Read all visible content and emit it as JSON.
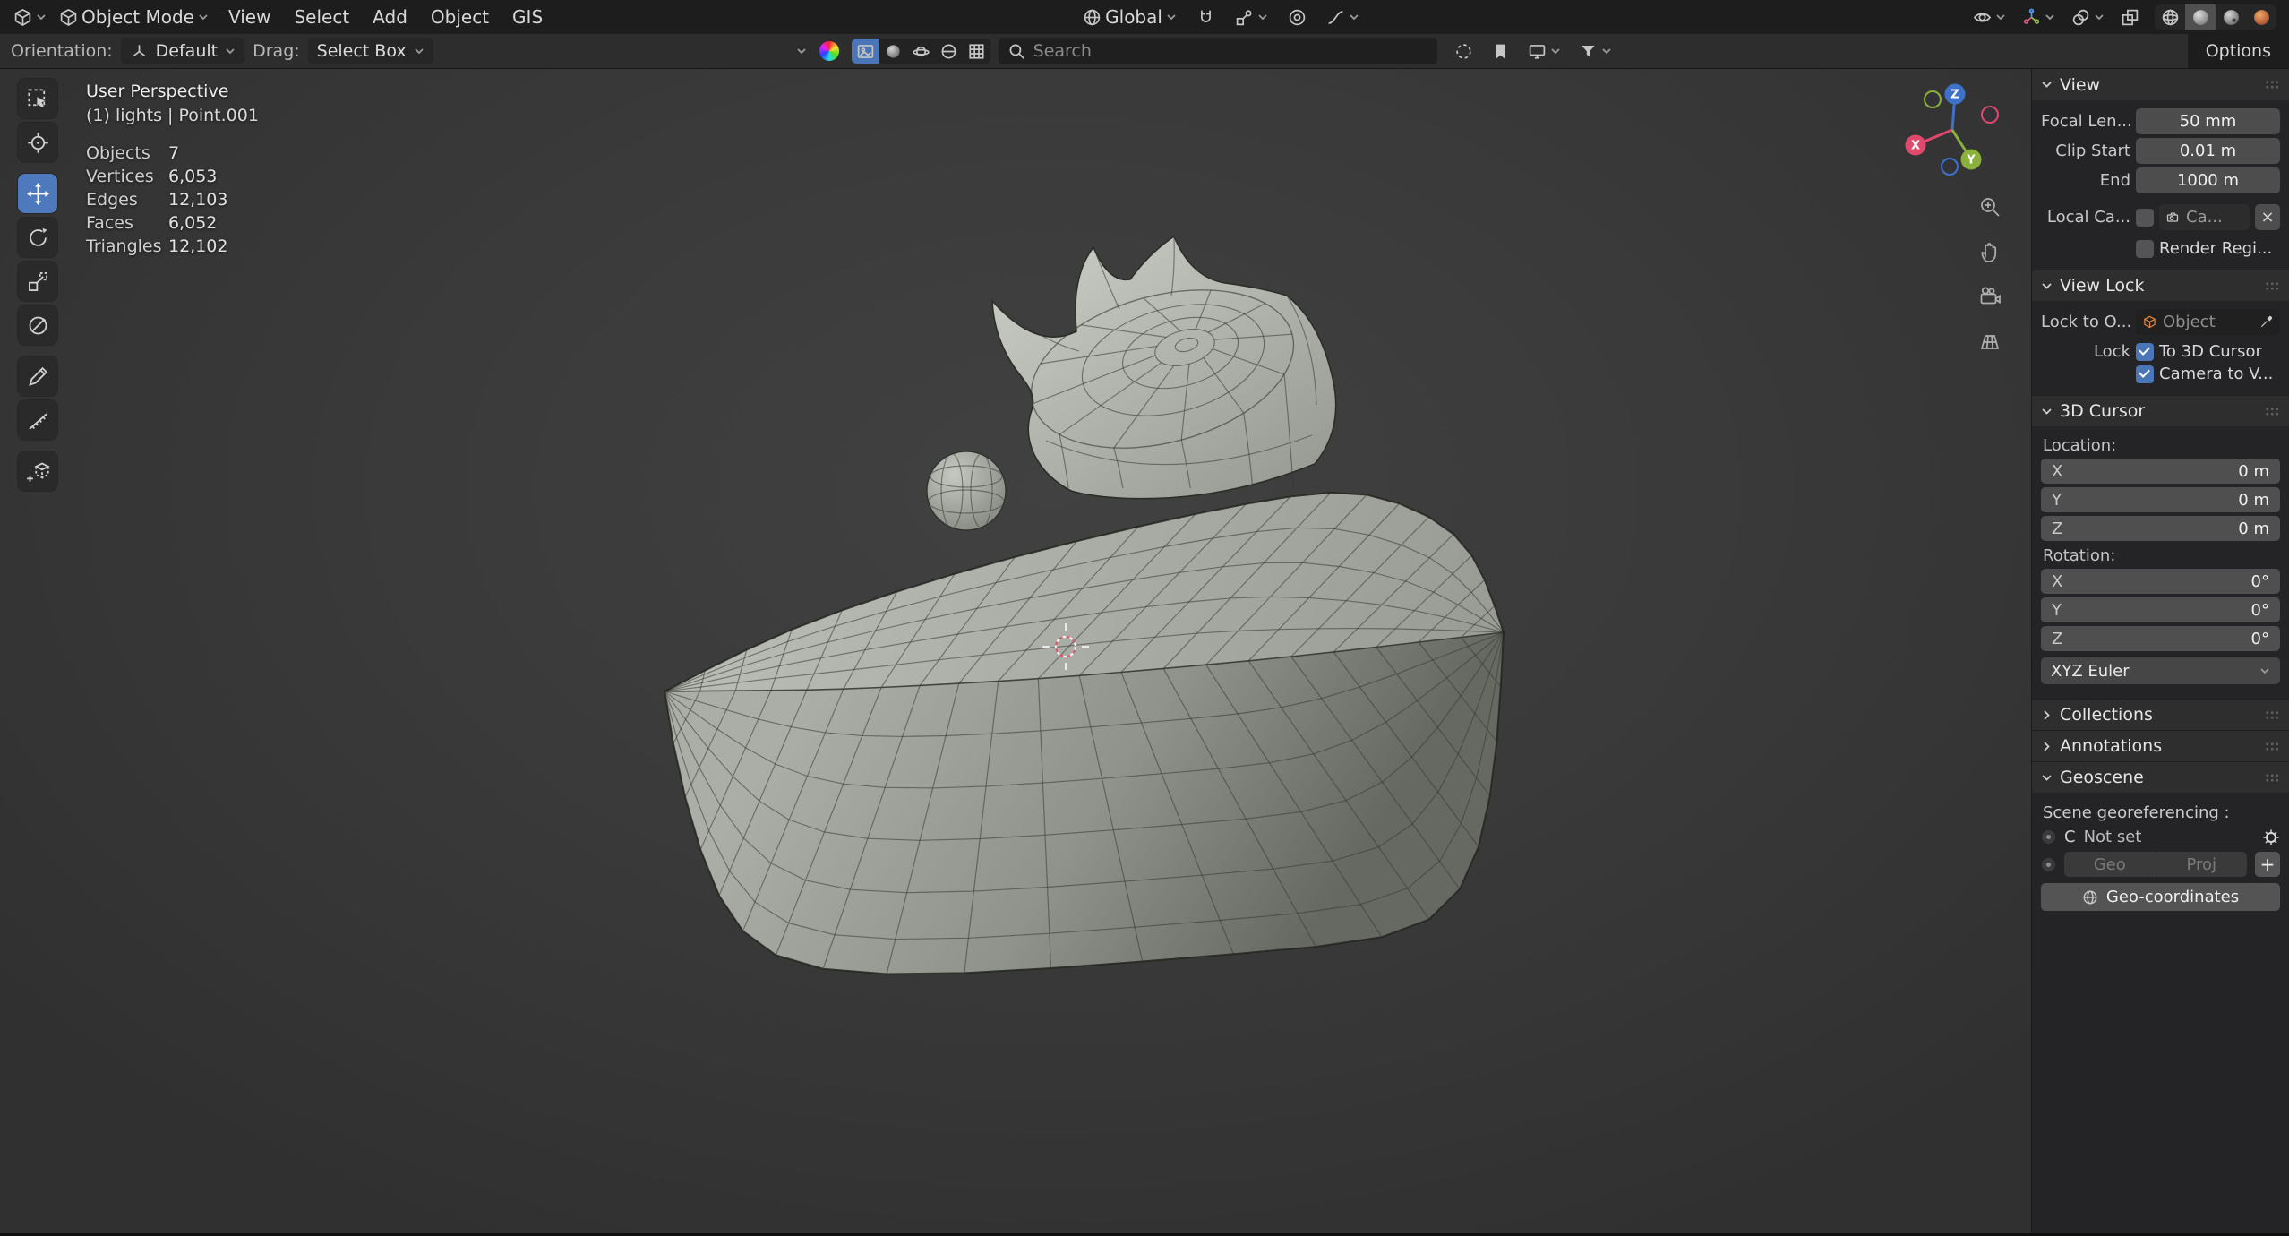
{
  "menubar": {
    "mode_label": "Object Mode",
    "menus": [
      "View",
      "Select",
      "Add",
      "Object",
      "GIS"
    ],
    "orientation_label": "Global"
  },
  "toolsettings": {
    "orientation_label": "Orientation:",
    "orientation_value": "Default",
    "drag_label": "Drag:",
    "drag_value": "Select Box",
    "search_placeholder": "Search",
    "options_label": "Options"
  },
  "viewport": {
    "view_label": "User Perspective",
    "context_label": "(1) lights | Point.001",
    "stats": [
      {
        "label": "Objects",
        "value": "7"
      },
      {
        "label": "Vertices",
        "value": "6,053"
      },
      {
        "label": "Edges",
        "value": "12,103"
      },
      {
        "label": "Faces",
        "value": "6,052"
      },
      {
        "label": "Triangles",
        "value": "12,102"
      }
    ],
    "gizmo": {
      "x": "X",
      "y": "Y",
      "z": "Z"
    }
  },
  "sidebar": {
    "view": {
      "title": "View",
      "focal_label": "Focal Len...",
      "focal_value": "50 mm",
      "clip_start_label": "Clip Start",
      "clip_start_value": "0.01 m",
      "clip_end_label": "End",
      "clip_end_value": "1000 m",
      "local_camera_label": "Local Ca...",
      "local_camera_value": "Ca...",
      "clear_label": "×",
      "render_region_label": "Render Regi..."
    },
    "view_lock": {
      "title": "View Lock",
      "lock_object_label": "Lock to O...",
      "lock_object_value": "Object",
      "lock_label": "Lock",
      "to_cursor_label": "To 3D Cursor",
      "camera_view_label": "Camera to V..."
    },
    "cursor": {
      "title": "3D Cursor",
      "location_label": "Location:",
      "rotation_label": "Rotation:",
      "location": [
        {
          "axis": "X",
          "value": "0 m"
        },
        {
          "axis": "Y",
          "value": "0 m"
        },
        {
          "axis": "Z",
          "value": "0 m"
        }
      ],
      "rotation": [
        {
          "axis": "X",
          "value": "0°"
        },
        {
          "axis": "Y",
          "value": "0°"
        },
        {
          "axis": "Z",
          "value": "0°"
        }
      ],
      "euler_value": "XYZ Euler"
    },
    "collections_title": "Collections",
    "annotations_title": "Annotations",
    "geoscene": {
      "title": "Geoscene",
      "georef_label": "Scene georeferencing :",
      "crs_label": "C",
      "crs_value": "Not set",
      "geo_label": "Geo",
      "proj_label": "Proj",
      "add_label": "+",
      "coords_button": "Geo-coordinates"
    }
  },
  "colors": {
    "accent": "#4a76b8",
    "axis_x": "#e0486c",
    "axis_y": "#8bb03b",
    "axis_z": "#3e72c9"
  }
}
